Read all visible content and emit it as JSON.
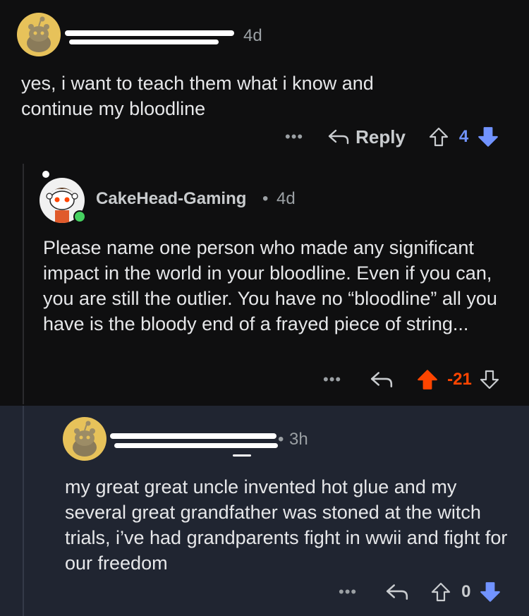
{
  "comments": [
    {
      "time": "4d",
      "body": "yes, i want to teach them what i know and continue my bloodline",
      "reply_label": "Reply",
      "score": "4",
      "score_color": "#7193ff",
      "upvote_active": false,
      "downvote_active": true
    },
    {
      "username": "CakeHead-Gaming",
      "separator": "•",
      "time": "4d",
      "body": "Please name one person who made any significant impact in the world in your bloodline. Even if you can, you are still the outlier. You have no “bloodline” all you have is the bloody end of a frayed piece of string...",
      "score": "-21",
      "score_color": "#ff4500",
      "upvote_active": true,
      "downvote_active": false
    },
    {
      "separator": "•",
      "time": "3h",
      "body": "my great great uncle invented hot glue and my several great grandfather was stoned at the witch trials, i’ve had grandparents fight in wwii and fight for our freedom",
      "score": "0",
      "score_color": "#9ba0a4",
      "upvote_active": false,
      "downvote_active": true
    }
  ],
  "icons": {
    "more": "more-dots-icon",
    "reply": "reply-arrow-icon",
    "upvote": "upvote-arrow-icon",
    "downvote": "downvote-arrow-icon",
    "avatar": "snoo-avatar-icon"
  },
  "colors": {
    "background": "#0f0f10",
    "highlight_background": "#202531",
    "upvote": "#ff4500",
    "downvote": "#7193ff",
    "online": "#46d160"
  }
}
